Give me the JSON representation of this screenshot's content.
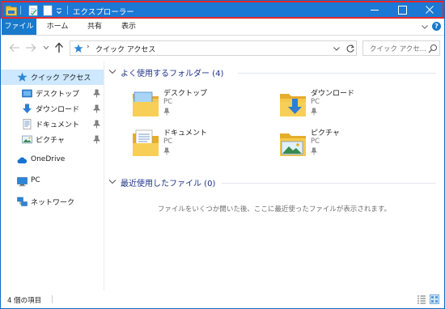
{
  "window": {
    "title": "エクスプローラー"
  },
  "ribbon": {
    "tabs": [
      {
        "label": "ファイル"
      },
      {
        "label": "ホーム"
      },
      {
        "label": "共有"
      },
      {
        "label": "表示"
      }
    ]
  },
  "navigation": {
    "address_path": "クイック アクセス",
    "search_placeholder": "クイック アクセ..."
  },
  "sidebar": {
    "items": [
      {
        "label": "クイック アクセス",
        "icon": "star-icon",
        "active": true
      },
      {
        "label": "デスクトップ",
        "icon": "desktop-folder-icon",
        "pinned": true
      },
      {
        "label": "ダウンロード",
        "icon": "download-arrow-icon",
        "pinned": true
      },
      {
        "label": "ドキュメント",
        "icon": "documents-icon",
        "pinned": true
      },
      {
        "label": "ピクチャ",
        "icon": "pictures-icon",
        "pinned": true
      },
      {
        "label": "OneDrive",
        "icon": "cloud-icon"
      },
      {
        "label": "PC",
        "icon": "computer-icon"
      },
      {
        "label": "ネットワーク",
        "icon": "network-icon"
      }
    ]
  },
  "content": {
    "frequent_folders": {
      "title": "よく使用するフォルダー (4)",
      "items": [
        {
          "name": "デスクトップ",
          "location": "PC"
        },
        {
          "name": "ダウンロード",
          "location": "PC"
        },
        {
          "name": "ドキュメント",
          "location": "PC"
        },
        {
          "name": "ピクチャ",
          "location": "PC"
        }
      ]
    },
    "recent_files": {
      "title": "最近使用したファイル (0)",
      "empty_message": "ファイルをいくつか開いた後、ここに最近使ったファイルが表示されます。"
    }
  },
  "status": {
    "item_count": "4 個の項目"
  },
  "colors": {
    "titlebar": "#1b78d4",
    "highlight_border": "#e8262a",
    "file_tab": "#1979ca",
    "active_item": "#cde8ff",
    "group_title": "#1e3287",
    "folder_yellow": "#f6c94b"
  }
}
